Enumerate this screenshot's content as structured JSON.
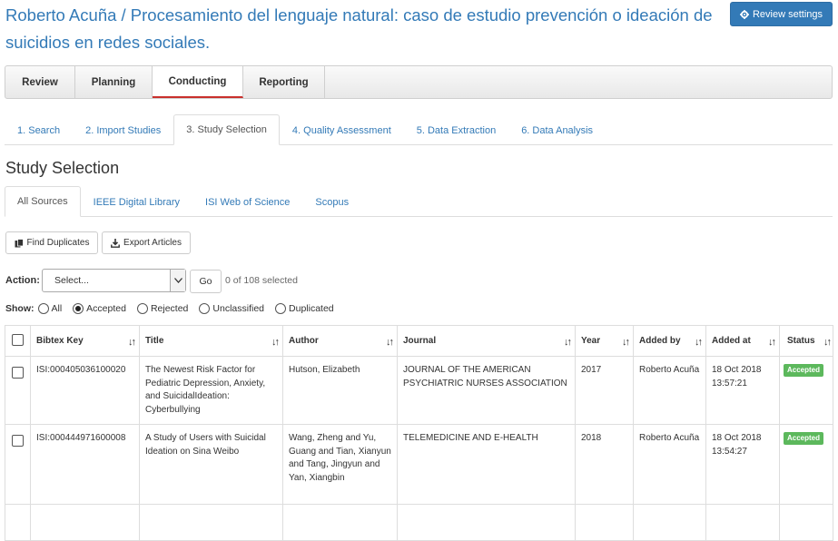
{
  "header": {
    "title": "Roberto Acuña / Procesamiento del lenguaje natural: caso de estudio prevención o ideación de suicidios en redes sociales.",
    "settings_label": "Review settings",
    "settings_icon": "gear-icon"
  },
  "phases": [
    "Review",
    "Planning",
    "Conducting",
    "Reporting"
  ],
  "steps": [
    "1. Search",
    "2. Import Studies",
    "3. Study Selection",
    "4. Quality Assessment",
    "5. Data Extraction",
    "6. Data Analysis"
  ],
  "section_title": "Study Selection",
  "sources": [
    "All Sources",
    "IEEE Digital Library",
    "ISI Web of Science",
    "Scopus"
  ],
  "toolbar": {
    "find_duplicates": "Find Duplicates",
    "export_articles": "Export Articles"
  },
  "action": {
    "label": "Action:",
    "select_value": "Select...",
    "go_label": "Go",
    "selected_count": "0 of 108 selected"
  },
  "show": {
    "label": "Show:",
    "options": [
      "All",
      "Accepted",
      "Rejected",
      "Unclassified",
      "Duplicated"
    ],
    "selected": "Accepted"
  },
  "table": {
    "columns": [
      "Bibtex Key",
      "Title",
      "Author",
      "Journal",
      "Year",
      "Added by",
      "Added at",
      "Status"
    ],
    "rows": [
      {
        "key": "ISI:000405036100020",
        "title": "The Newest Risk Factor for Pediatric Depression, Anxiety, and SuicidalIdeation: Cyberbullying",
        "author": "Hutson, Elizabeth",
        "journal": "JOURNAL OF THE AMERICAN PSYCHIATRIC NURSES ASSOCIATION",
        "year": "2017",
        "added_by": "Roberto Acuña",
        "added_at": "18 Oct 2018 13:57:21",
        "status": "Accepted"
      },
      {
        "key": "ISI:000444971600008",
        "title": "A Study of Users with Suicidal Ideation on Sina Weibo",
        "author": "Wang, Zheng and Yu, Guang and Tian, Xianyun and Tang, Jingyun and Yan, Xiangbin",
        "journal": "TELEMEDICINE AND E-HEALTH",
        "year": "2018",
        "added_by": "Roberto Acuña",
        "added_at": "18 Oct 2018 13:54:27",
        "status": "Accepted"
      }
    ]
  },
  "colors": {
    "link": "#337ab7",
    "primary_button": "#337ab7",
    "accepted_badge": "#5cb85c",
    "active_phase_underline": "#c9302c"
  }
}
